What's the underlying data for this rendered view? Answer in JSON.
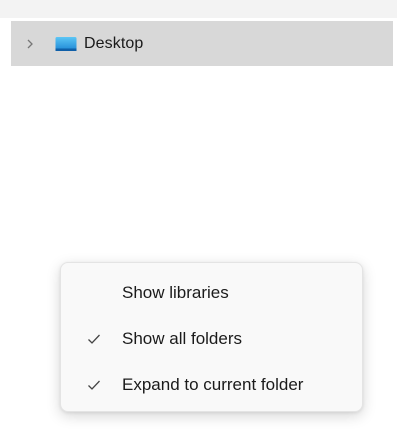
{
  "navigation_pane": {
    "items": [
      {
        "label": "Desktop",
        "icon": "desktop-folder-icon",
        "expand_icon": "chevron-right-icon",
        "selected": true
      }
    ]
  },
  "context_menu": {
    "items": [
      {
        "label": "Show libraries",
        "checked": false
      },
      {
        "label": "Show all folders",
        "checked": true
      },
      {
        "label": "Expand to current folder",
        "checked": true
      }
    ]
  },
  "colors": {
    "selection_background": "#d8d8d8",
    "folder_icon": "#2ba0e6",
    "menu_background": "#f9f9f9"
  }
}
